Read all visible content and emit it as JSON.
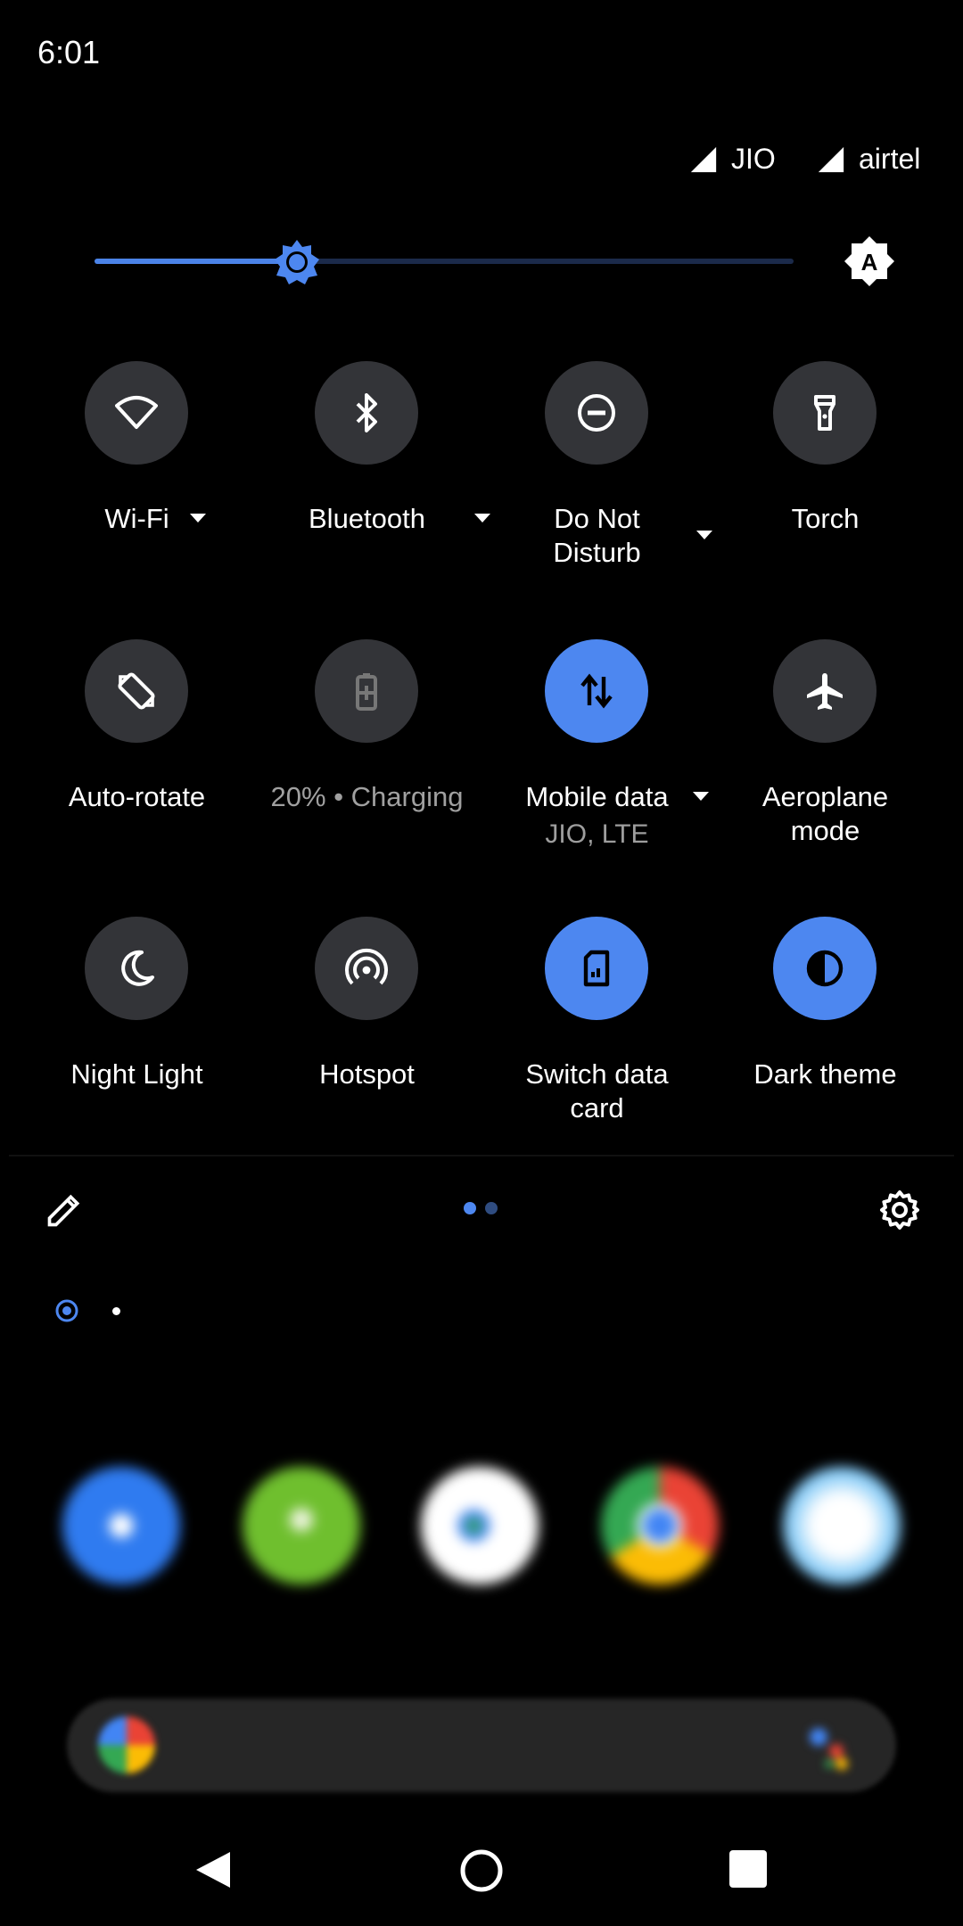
{
  "status_bar": {
    "time": "6:01",
    "carriers": [
      "JIO",
      "airtel"
    ]
  },
  "brightness": {
    "level": 0.29
  },
  "tiles": [
    {
      "label": "Wi-Fi",
      "icon": "wifi-icon",
      "active": false,
      "has_menu": true
    },
    {
      "label": "Bluetooth",
      "icon": "bluetooth-icon",
      "active": false,
      "has_menu": true
    },
    {
      "label": "Do Not Disturb",
      "icon": "do-not-disturb-icon",
      "active": false,
      "has_menu": true
    },
    {
      "label": "Torch",
      "icon": "torch-icon",
      "active": false,
      "has_menu": false
    },
    {
      "label": "Auto-rotate",
      "icon": "auto-rotate-icon",
      "active": false,
      "has_menu": false
    },
    {
      "label": "20% • Charging",
      "icon": "battery-charging-icon",
      "active": false,
      "has_menu": false
    },
    {
      "label": "Mobile data",
      "sublabel": "JIO, LTE",
      "icon": "mobile-data-icon",
      "active": true,
      "has_menu": true
    },
    {
      "label": "Aeroplane mode",
      "icon": "airplane-icon",
      "active": false,
      "has_menu": false
    },
    {
      "label": "Night Light",
      "icon": "night-light-icon",
      "active": false,
      "has_menu": false
    },
    {
      "label": "Hotspot",
      "icon": "hotspot-icon",
      "active": false,
      "has_menu": false
    },
    {
      "label": "Switch data card",
      "icon": "sim-card-icon",
      "active": true,
      "has_menu": false
    },
    {
      "label": "Dark theme",
      "icon": "dark-theme-icon",
      "active": true,
      "has_menu": false
    }
  ],
  "footer": {
    "page_count": 2,
    "current_page": 1
  },
  "home": {
    "apps": [
      "phone-app-icon",
      "messages-app-icon",
      "play-store-app-icon",
      "chrome-app-icon",
      "camera-app-icon"
    ]
  },
  "colors": {
    "accent": "#4d87f0",
    "tile_off": "#333438",
    "background": "#000000"
  }
}
